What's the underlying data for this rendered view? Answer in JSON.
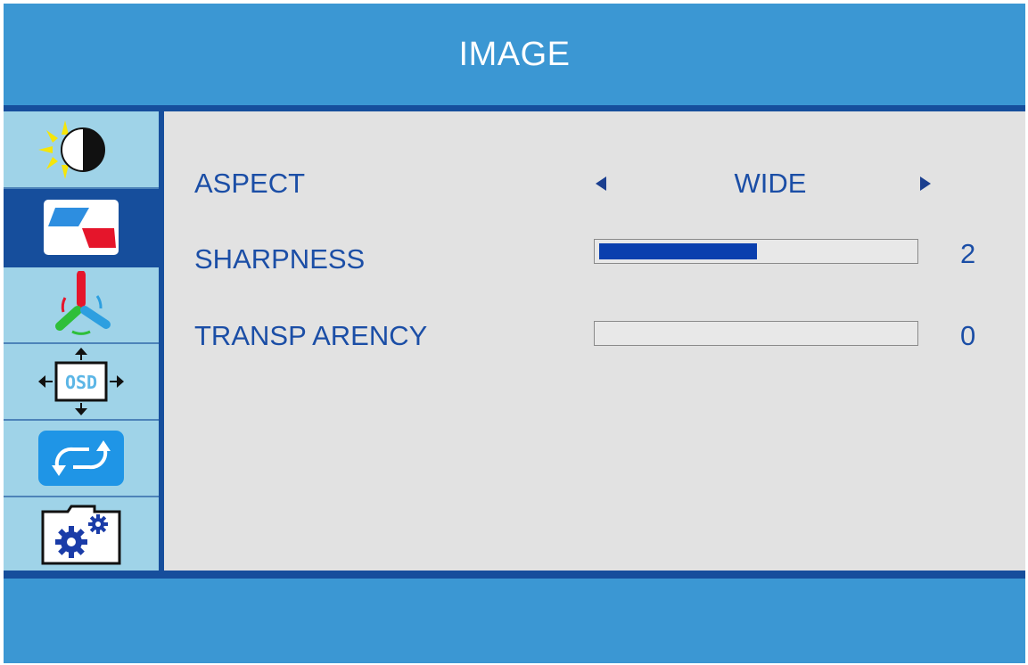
{
  "header": {
    "title": "IMAGE"
  },
  "sidebar": {
    "items": [
      {
        "name": "luminance",
        "icon": "brightness-contrast-icon"
      },
      {
        "name": "image",
        "icon": "image-setup-icon",
        "selected": true
      },
      {
        "name": "color",
        "icon": "color-temperature-icon"
      },
      {
        "name": "osd",
        "icon": "osd-position-icon",
        "icon_text": "OSD"
      },
      {
        "name": "reset",
        "icon": "reset-arrows-icon"
      },
      {
        "name": "misc",
        "icon": "gear-settings-icon"
      }
    ]
  },
  "settings": {
    "aspect": {
      "label": "ASPECT",
      "value": "WIDE"
    },
    "sharpness": {
      "label": "SHARPNESS",
      "value": "2",
      "level": 0.5
    },
    "transparency": {
      "label": "TRANSP ARENCY",
      "value": "0",
      "level": 0
    }
  },
  "colors": {
    "panel_blue": "#3b97d3",
    "dark_blue": "#164e9c",
    "text_blue": "#1b4ea6",
    "sidebar_bg": "#9fd3e8",
    "content_bg": "#e2e2e2",
    "bar_fill": "#0a3fae"
  }
}
